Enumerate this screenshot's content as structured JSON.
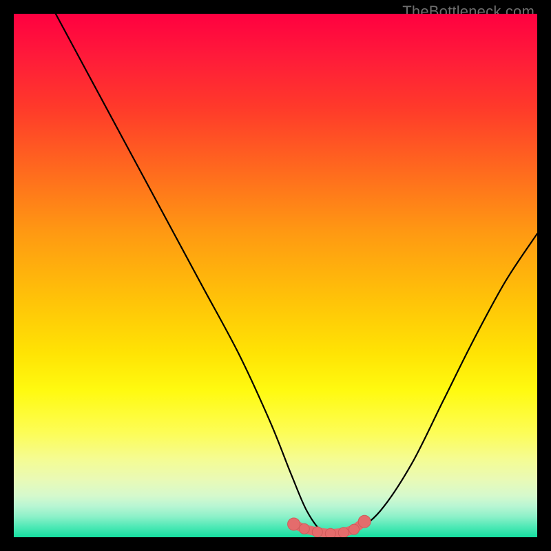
{
  "watermark": "TheBottleneck.com",
  "colors": {
    "frame": "#000000",
    "curve": "#000000",
    "marker_fill": "#e46c6c",
    "marker_stroke": "#cf5a5a",
    "gradient_top": "#ff0040",
    "gradient_bottom": "#15dfa0"
  },
  "chart_data": {
    "type": "line",
    "title": "",
    "xlabel": "",
    "ylabel": "",
    "xlim": [
      0,
      100
    ],
    "ylim": [
      0,
      100
    ],
    "grid": false,
    "series": [
      {
        "name": "bottleneck-curve",
        "x": [
          8,
          15,
          22,
          29,
          36,
          43,
          49,
          53,
          56,
          59,
          62,
          65,
          70,
          76,
          82,
          88,
          94,
          100
        ],
        "y": [
          100,
          87,
          74,
          61,
          48,
          35,
          22,
          12,
          5,
          1,
          0.5,
          1,
          5,
          14,
          26,
          38,
          49,
          58
        ]
      }
    ],
    "markers": {
      "name": "optimal-zone",
      "x": [
        53.5,
        55.5,
        58,
        60.5,
        63,
        65,
        67
      ],
      "y": [
        2.5,
        1.6,
        1.0,
        0.7,
        0.9,
        1.5,
        3.0
      ]
    }
  }
}
